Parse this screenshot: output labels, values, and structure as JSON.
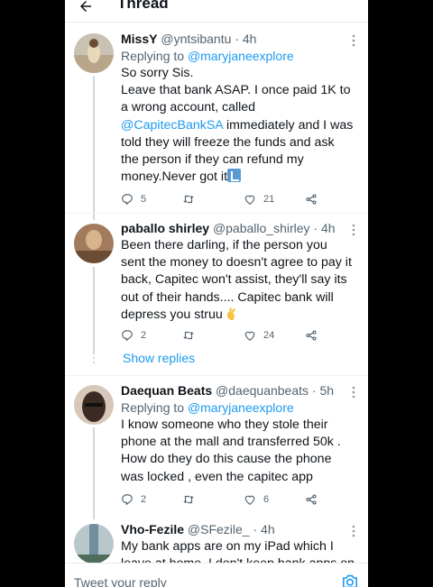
{
  "header": {
    "title": "Thread"
  },
  "tweets": [
    {
      "name": "MissY",
      "handle": "@yntsibantu",
      "time": "· 4h",
      "reply_prefix": "Replying to ",
      "reply_to": "@maryjaneexplore",
      "lines": [
        "So sorry Sis.",
        "Leave that bank ASAP. I once paid 1K to",
        "a wrong account, called"
      ],
      "mention": "@CapitecBankSA",
      "mention_tail": " immediately and I was",
      "lines2": [
        "told they will freeze the funds and ask",
        "the person if they can refund my",
        "money.Never got it"
      ],
      "replies": "5",
      "retweets": "",
      "likes": "21",
      "avatar_colors": [
        "#c9c2b3",
        "#e8d9b8",
        "#b9a58a"
      ]
    },
    {
      "name": "paballo shirley",
      "handle": "@paballo_shirley",
      "time": "· 4h",
      "lines": [
        "Been there darling, if the  person you",
        "sent the money to doesn't agree to pay it",
        "back, Capitec won't assist, they'll say its",
        "out of their hands.... Capitec bank will",
        "depress you struu"
      ],
      "replies": "2",
      "retweets": "",
      "likes": "24",
      "avatar_colors": [
        "#a27b5c",
        "#d8b48c",
        "#6b4d35"
      ]
    },
    {
      "name": "Daequan Beats",
      "handle": "@daequanbeats",
      "time": "· 5h",
      "reply_prefix": "Replying to ",
      "reply_to": "@maryjaneexplore",
      "lines": [
        "I know someone who they stole their",
        "phone at the mall and transferred 50k .",
        "How do they do this cause the phone",
        "was locked , even the capitec app"
      ],
      "replies": "2",
      "retweets": "",
      "likes": "6",
      "avatar_colors": [
        "#3b2a22",
        "#8a6b55",
        "#d6c7b8"
      ]
    },
    {
      "name": "Vho-Fezile",
      "handle": "@SFezile_",
      "time": "· 4h",
      "lines": [
        "My bank apps are on my iPad which I",
        "leave at home. I don't keep bank apps on"
      ],
      "avatar_colors": [
        "#6f8f9e",
        "#b8c7cc",
        "#4f6d5a"
      ]
    }
  ],
  "show_replies": "Show replies",
  "composer": {
    "placeholder": "Tweet your reply"
  },
  "icons": {
    "back": "arrow-left-icon",
    "more": "more-vertical-icon",
    "reply": "reply-icon",
    "retweet": "retweet-icon",
    "like": "heart-icon",
    "share": "share-icon",
    "camera": "camera-icon"
  },
  "colors": {
    "accent": "#1d9bf0",
    "muted": "#536471",
    "text": "#0f1419"
  }
}
